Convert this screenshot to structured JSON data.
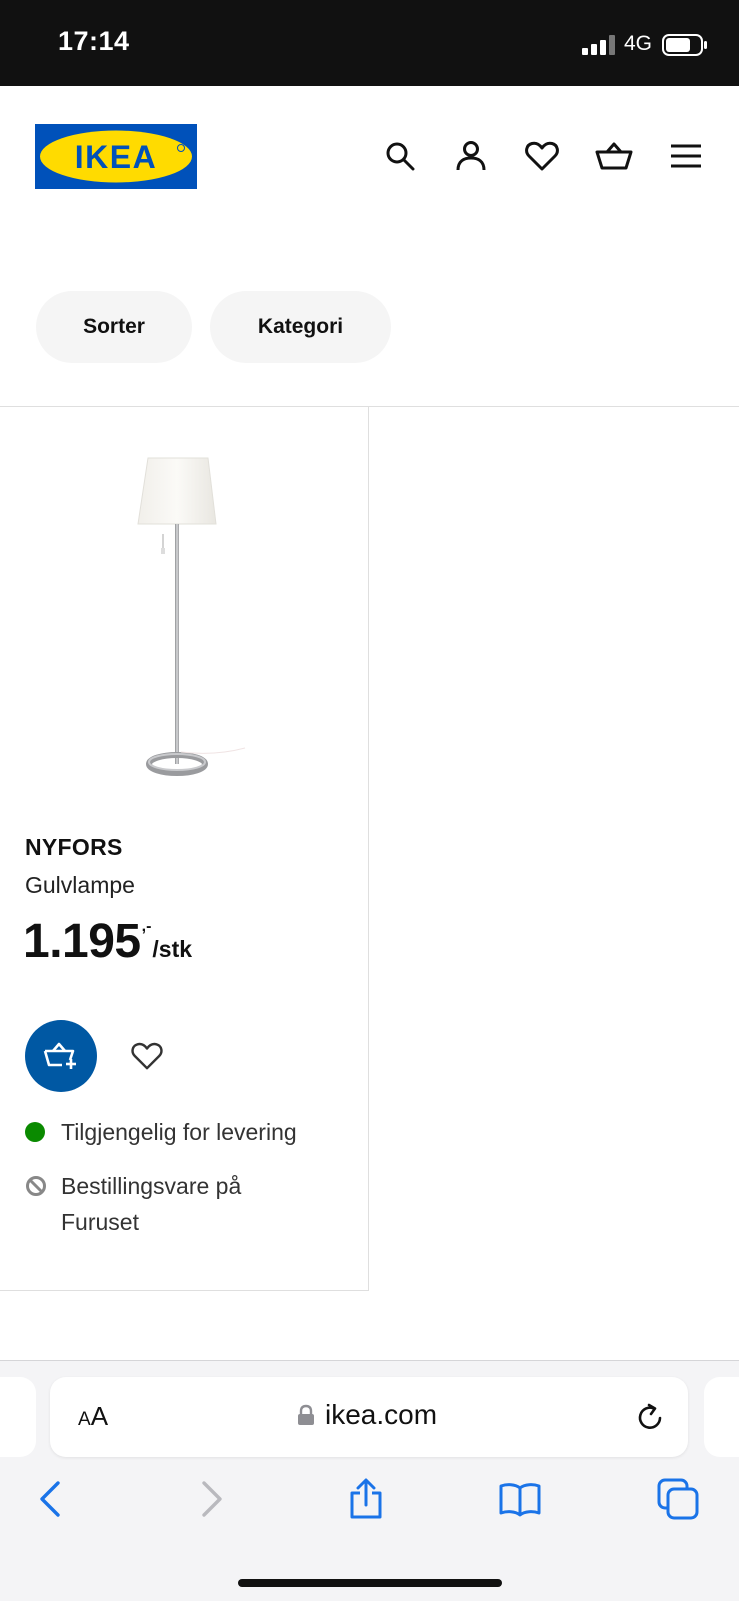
{
  "status_bar": {
    "time": "17:14",
    "network": "4G"
  },
  "header": {
    "logo_text": "IKEA",
    "icons": [
      "search-icon",
      "account-icon",
      "heart-icon",
      "basket-icon",
      "menu-icon"
    ]
  },
  "filters": {
    "sort_label": "Sorter",
    "category_label": "Kategori"
  },
  "product": {
    "name": "NYFORS",
    "description": "Gulvlampe",
    "price_integer": "1.195",
    "price_decimal": ",-",
    "price_unit": "/stk",
    "availability": [
      {
        "icon": "green-dot-icon",
        "text": "Tilgjengelig for levering"
      },
      {
        "icon": "unavailable-icon",
        "text": "Bestillingsvare på Furuset"
      }
    ]
  },
  "browser": {
    "text_size_label_small": "A",
    "text_size_label_large": "A",
    "url": "ikea.com",
    "toolbar_icons": [
      "back-icon",
      "forward-icon",
      "share-icon",
      "bookmarks-icon",
      "tabs-icon"
    ]
  },
  "colors": {
    "ikea_blue": "#0058a3",
    "ikea_yellow": "#ffdb00",
    "logo_blue": "#0051ba",
    "available_green": "#0a8a00",
    "safari_blue": "#1a73e8"
  }
}
